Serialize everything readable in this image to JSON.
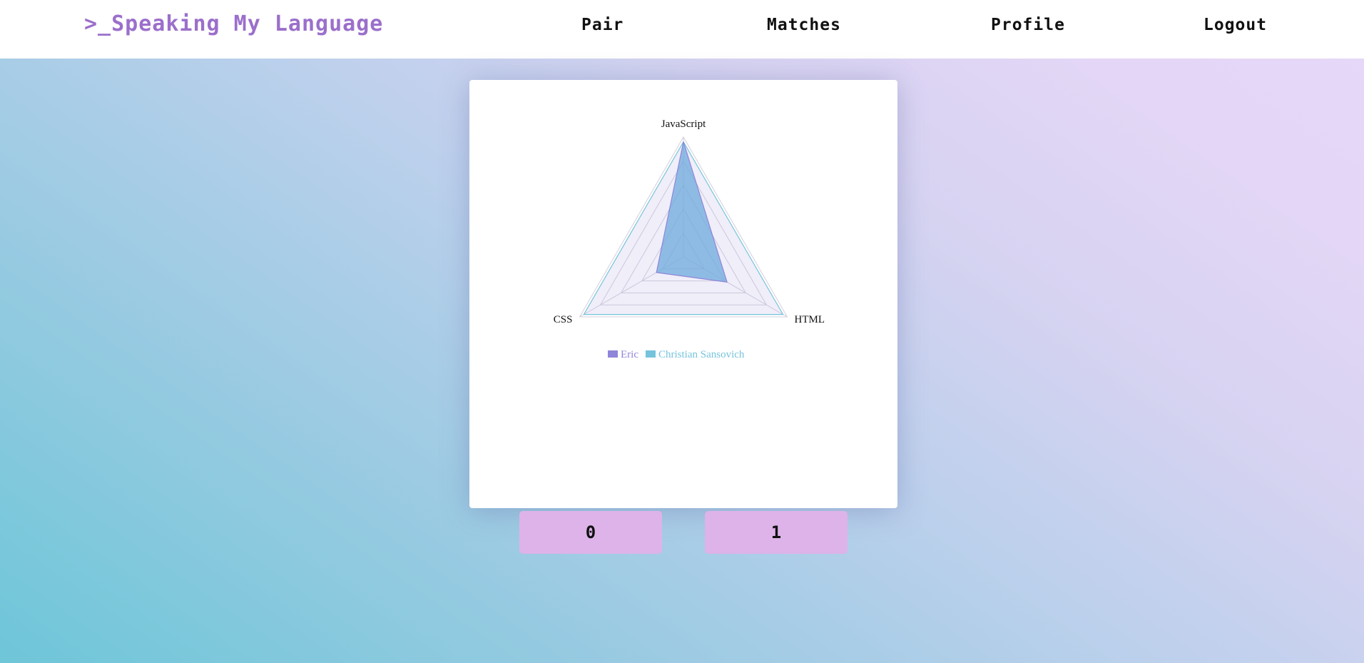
{
  "nav": {
    "brand": ">_Speaking My Language",
    "links": [
      "Pair",
      "Matches",
      "Profile",
      "Logout"
    ]
  },
  "colors": {
    "brand": "#9b6fcb",
    "series_eric": "#8f85d9",
    "series_christian": "#76c4dc",
    "button": "#ddb3e9"
  },
  "buttons": {
    "left": "0",
    "right": "1"
  },
  "chart_data": {
    "type": "radar",
    "axes": [
      "JavaScript",
      "HTML",
      "CSS"
    ],
    "scale": {
      "min": 0,
      "max": 5,
      "levels": 5
    },
    "grid": true,
    "legend": "bottom",
    "series": [
      {
        "name": "Eric",
        "values": [
          4.8,
          2.1,
          1.3
        ]
      },
      {
        "name": "Christian Sansovich",
        "values": [
          4.8,
          4.8,
          4.8
        ]
      }
    ]
  }
}
